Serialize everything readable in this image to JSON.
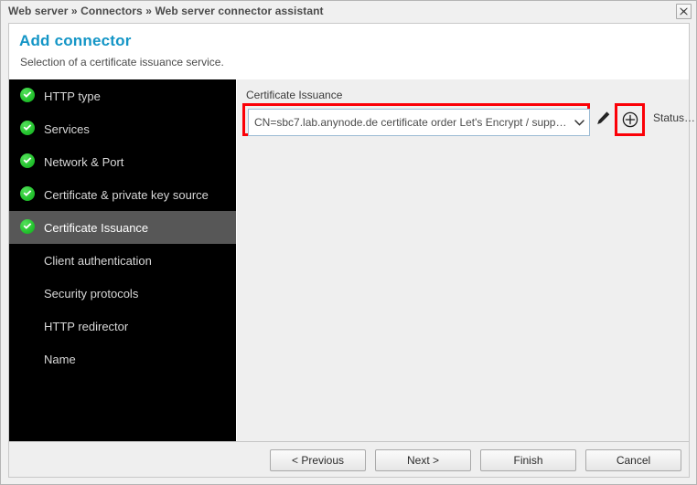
{
  "window": {
    "breadcrumb": "Web server » Connectors » Web server connector assistant",
    "close_icon": "close-icon"
  },
  "dialog": {
    "title": "Add connector",
    "subtitle": "Selection of a certificate issuance service.",
    "accent_color": "#1395c6",
    "highlight_color": "#fb0007"
  },
  "sidebar": {
    "items": [
      {
        "label": "HTTP type",
        "completed": true,
        "active": false
      },
      {
        "label": "Services",
        "completed": true,
        "active": false
      },
      {
        "label": "Network & Port",
        "completed": true,
        "active": false
      },
      {
        "label": "Certificate & private key source",
        "completed": true,
        "active": false
      },
      {
        "label": "Certificate Issuance",
        "completed": true,
        "active": true
      },
      {
        "label": "Client authentication",
        "completed": false,
        "active": false
      },
      {
        "label": "Security protocols",
        "completed": false,
        "active": false
      },
      {
        "label": "HTTP redirector",
        "completed": false,
        "active": false
      },
      {
        "label": "Name",
        "completed": false,
        "active": false
      }
    ]
  },
  "content": {
    "field_label": "Certificate Issuance",
    "select": {
      "value": "CN=sbc7.lab.anynode.de certificate order Let's Encrypt / supp…",
      "arrow_icon": "chevron-down-icon"
    },
    "edit_icon": "pencil-icon",
    "add_icon": "plus-circle-icon",
    "status_label": "Status…"
  },
  "footer": {
    "buttons": [
      {
        "label": "< Previous"
      },
      {
        "label": "Next >"
      },
      {
        "label": "Finish"
      },
      {
        "label": "Cancel"
      }
    ]
  }
}
